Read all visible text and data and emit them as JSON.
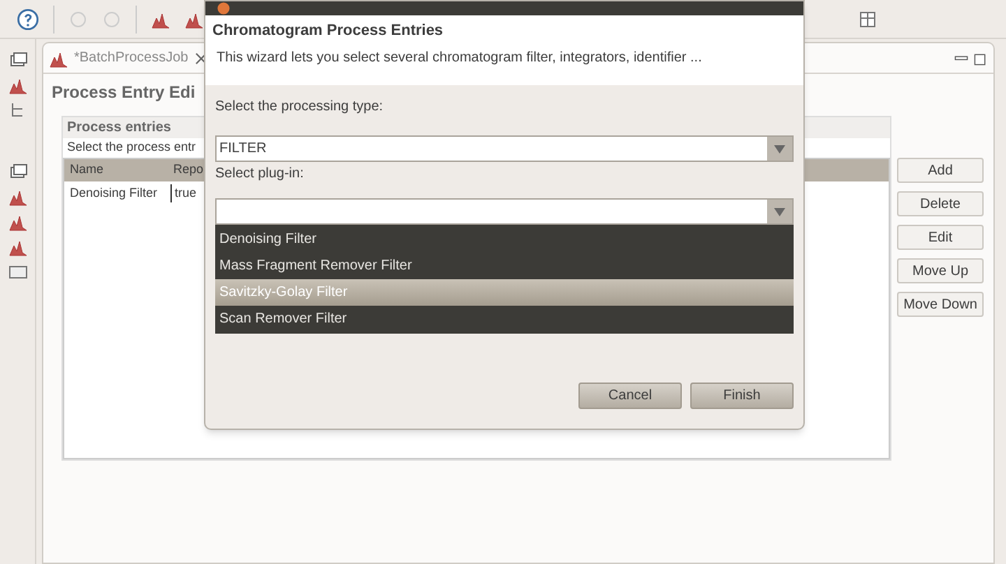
{
  "editor": {
    "tab": {
      "label": "*BatchProcessJob",
      "dirty": true
    },
    "heading": "Process Entry Edi",
    "section": {
      "title": "Process entries",
      "description": "Select the process entr"
    },
    "table": {
      "columns": [
        "Name",
        "Repo"
      ],
      "rows": [
        [
          "Denoising Filter",
          "true"
        ]
      ]
    },
    "buttons": [
      "Add",
      "Delete",
      "Edit",
      "Move Up",
      "Move Down"
    ]
  },
  "dialog": {
    "title": "Chromatogram Process Entries",
    "description": "This wizard lets you select several chromatogram filter, integrators, identifier ...",
    "type_label": "Select the processing type:",
    "type_value": "FILTER",
    "plugin_label": "Select plug-in:",
    "options": [
      {
        "label": "Denoising Filter",
        "selected": false
      },
      {
        "label": "Mass Fragment Remover Filter",
        "selected": false
      },
      {
        "label": "Savitzky-Golay Filter",
        "selected": true
      },
      {
        "label": "Scan Remover Filter",
        "selected": false
      }
    ],
    "buttons": [
      "Cancel",
      "Finish"
    ]
  }
}
